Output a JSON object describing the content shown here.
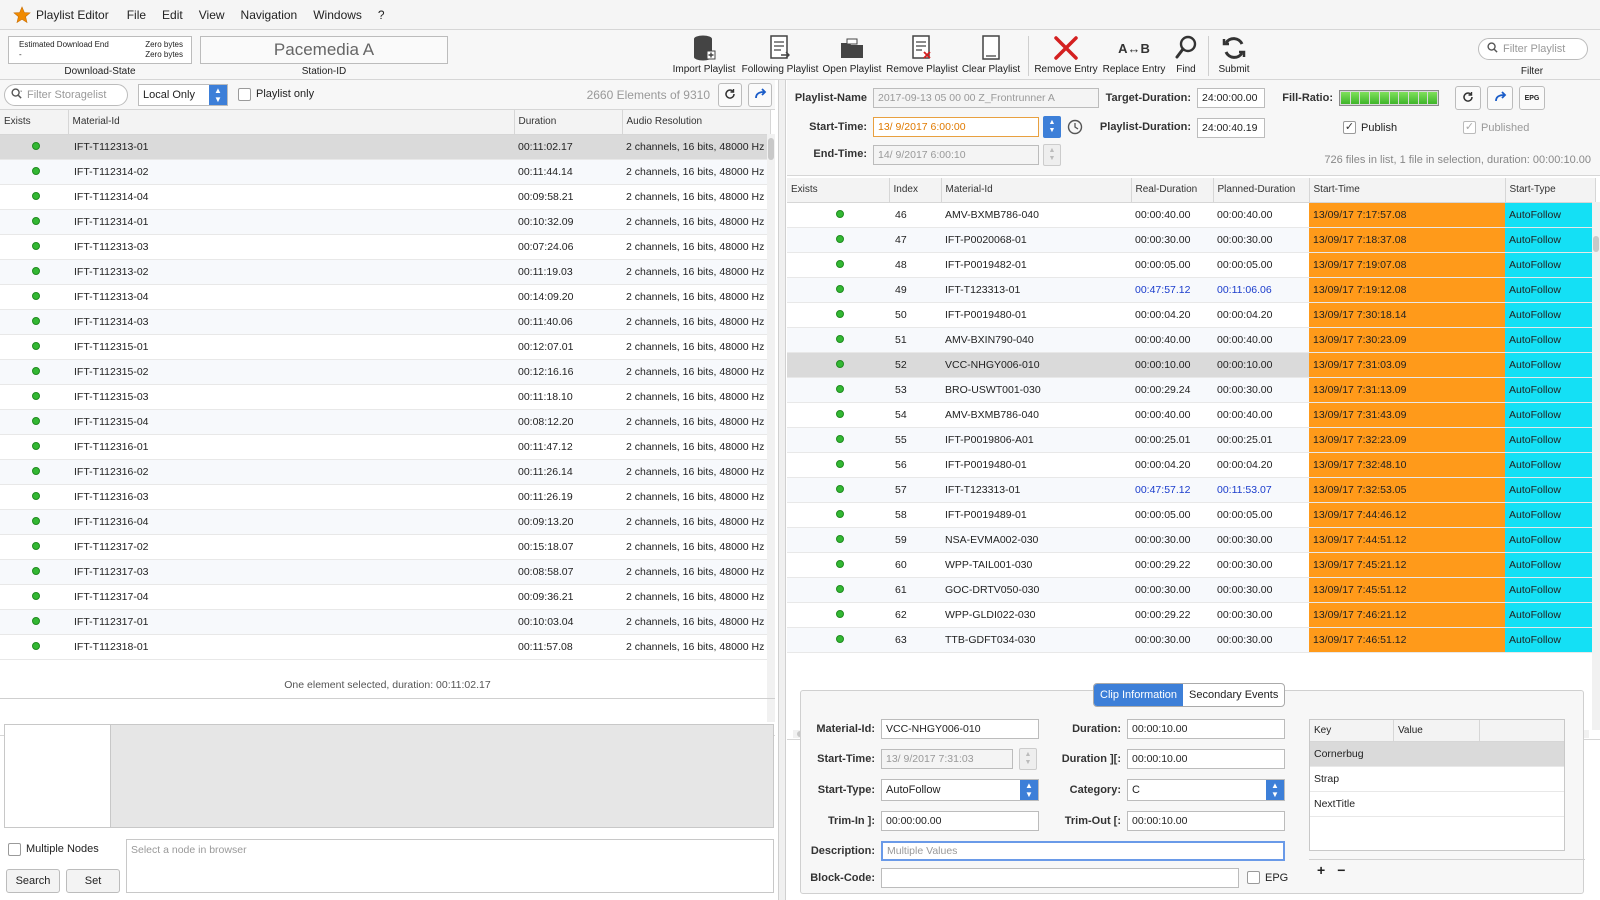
{
  "menubar": {
    "app_title": "Playlist Editor",
    "items": [
      "File",
      "Edit",
      "View",
      "Navigation",
      "Windows",
      "?"
    ]
  },
  "toolbar": {
    "download_state": {
      "line1_left": "Estimated Download End",
      "line2_left": "-",
      "line1_right": "Zero bytes",
      "line2_right": "Zero bytes",
      "caption": "Download-State"
    },
    "station": {
      "value": "Pacemedia A",
      "caption": "Station-ID"
    },
    "buttons": {
      "import": "Import Playlist",
      "following": "Following Playlist",
      "open": "Open Playlist",
      "remove_playlist": "Remove Playlist",
      "clear": "Clear Playlist",
      "remove_entry": "Remove Entry",
      "replace_icon_text": "A↔B",
      "replace": "Replace Entry",
      "find": "Find",
      "submit": "Submit"
    },
    "filter_placeholder": "Filter Playlist",
    "filter_caption": "Filter"
  },
  "left": {
    "filter_placeholder": "Filter Storagelist",
    "scope_select": "Local Only",
    "playlist_only_label": "Playlist only",
    "element_count": "2660 Elements of 9310",
    "columns": [
      "Exists",
      "Material-Id",
      "Duration",
      "Audio Resolution"
    ],
    "rows": [
      [
        "IFT-T112313-01",
        "00:11:02.17",
        "2 channels, 16 bits, 48000 Hz"
      ],
      [
        "IFT-T112314-02",
        "00:11:44.14",
        "2 channels, 16 bits, 48000 Hz"
      ],
      [
        "IFT-T112314-04",
        "00:09:58.21",
        "2 channels, 16 bits, 48000 Hz"
      ],
      [
        "IFT-T112314-01",
        "00:10:32.09",
        "2 channels, 16 bits, 48000 Hz"
      ],
      [
        "IFT-T112313-03",
        "00:07:24.06",
        "2 channels, 16 bits, 48000 Hz"
      ],
      [
        "IFT-T112313-02",
        "00:11:19.03",
        "2 channels, 16 bits, 48000 Hz"
      ],
      [
        "IFT-T112313-04",
        "00:14:09.20",
        "2 channels, 16 bits, 48000 Hz"
      ],
      [
        "IFT-T112314-03",
        "00:11:40.06",
        "2 channels, 16 bits, 48000 Hz"
      ],
      [
        "IFT-T112315-01",
        "00:12:07.01",
        "2 channels, 16 bits, 48000 Hz"
      ],
      [
        "IFT-T112315-02",
        "00:12:16.16",
        "2 channels, 16 bits, 48000 Hz"
      ],
      [
        "IFT-T112315-03",
        "00:11:18.10",
        "2 channels, 16 bits, 48000 Hz"
      ],
      [
        "IFT-T112315-04",
        "00:08:12.20",
        "2 channels, 16 bits, 48000 Hz"
      ],
      [
        "IFT-T112316-01",
        "00:11:47.12",
        "2 channels, 16 bits, 48000 Hz"
      ],
      [
        "IFT-T112316-02",
        "00:11:26.14",
        "2 channels, 16 bits, 48000 Hz"
      ],
      [
        "IFT-T112316-03",
        "00:11:26.19",
        "2 channels, 16 bits, 48000 Hz"
      ],
      [
        "IFT-T112316-04",
        "00:09:13.20",
        "2 channels, 16 bits, 48000 Hz"
      ],
      [
        "IFT-T112317-02",
        "00:15:18.07",
        "2 channels, 16 bits, 48000 Hz"
      ],
      [
        "IFT-T112317-03",
        "00:08:58.07",
        "2 channels, 16 bits, 48000 Hz"
      ],
      [
        "IFT-T112317-04",
        "00:09:36.21",
        "2 channels, 16 bits, 48000 Hz"
      ],
      [
        "IFT-T112317-01",
        "00:10:03.04",
        "2 channels, 16 bits, 48000 Hz"
      ],
      [
        "IFT-T112318-01",
        "00:11:57.08",
        "2 channels, 16 bits, 48000 Hz"
      ]
    ],
    "status": "One element selected, duration: 00:11:02.17",
    "multiple_nodes_label": "Multiple Nodes",
    "node_placeholder": "Select a node in browser",
    "search_label": "Search",
    "set_label": "Set"
  },
  "right": {
    "playlist_name_label": "Playlist-Name",
    "playlist_name": "2017-09-13 05 00 00 Z_Frontrunner A",
    "target_duration_label": "Target-Duration:",
    "target_duration": "24:00:00.00",
    "fill_ratio_label": "Fill-Ratio:",
    "fill_ratio": 1.0,
    "epg_label": "EPG",
    "start_time_label": "Start-Time:",
    "start_time": "13/ 9/2017   6:00:00",
    "playlist_duration_label": "Playlist-Duration:",
    "playlist_duration": "24:00:40.19",
    "publish_label": "Publish",
    "published_label": "Published",
    "end_time_label": "End-Time:",
    "end_time": "14/ 9/2017   6:00:10",
    "summary": "726 files in list, 1 file in selection, duration: 00:00:10.00",
    "columns": [
      "Exists",
      "Index",
      "Material-Id",
      "Real-Duration",
      "Planned-Duration",
      "Start-Time",
      "Start-Type"
    ],
    "rows": [
      [
        "46",
        "AMV-BXMB786-040",
        "00:00:40.00",
        "00:00:40.00",
        "13/09/17 7:17:57.08",
        "AutoFollow"
      ],
      [
        "47",
        "IFT-P0020068-01",
        "00:00:30.00",
        "00:00:30.00",
        "13/09/17 7:18:37.08",
        "AutoFollow"
      ],
      [
        "48",
        "IFT-P0019482-01",
        "00:00:05.00",
        "00:00:05.00",
        "13/09/17 7:19:07.08",
        "AutoFollow"
      ],
      [
        "49",
        "IFT-T123313-01",
        "00:47:57.12",
        "00:11:06.06",
        "13/09/17 7:19:12.08",
        "AutoFollow"
      ],
      [
        "50",
        "IFT-P0019480-01",
        "00:00:04.20",
        "00:00:04.20",
        "13/09/17 7:30:18.14",
        "AutoFollow"
      ],
      [
        "51",
        "AMV-BXIN790-040",
        "00:00:40.00",
        "00:00:40.00",
        "13/09/17 7:30:23.09",
        "AutoFollow"
      ],
      [
        "52",
        "VCC-NHGY006-010",
        "00:00:10.00",
        "00:00:10.00",
        "13/09/17 7:31:03.09",
        "AutoFollow"
      ],
      [
        "53",
        "BRO-USWT001-030",
        "00:00:29.24",
        "00:00:30.00",
        "13/09/17 7:31:13.09",
        "AutoFollow"
      ],
      [
        "54",
        "AMV-BXMB786-040",
        "00:00:40.00",
        "00:00:40.00",
        "13/09/17 7:31:43.09",
        "AutoFollow"
      ],
      [
        "55",
        "IFT-P0019806-A01",
        "00:00:25.01",
        "00:00:25.01",
        "13/09/17 7:32:23.09",
        "AutoFollow"
      ],
      [
        "56",
        "IFT-P0019480-01",
        "00:00:04.20",
        "00:00:04.20",
        "13/09/17 7:32:48.10",
        "AutoFollow"
      ],
      [
        "57",
        "IFT-T123313-01",
        "00:47:57.12",
        "00:11:53.07",
        "13/09/17 7:32:53.05",
        "AutoFollow"
      ],
      [
        "58",
        "IFT-P0019489-01",
        "00:00:05.00",
        "00:00:05.00",
        "13/09/17 7:44:46.12",
        "AutoFollow"
      ],
      [
        "59",
        "NSA-EVMA002-030",
        "00:00:30.00",
        "00:00:30.00",
        "13/09/17 7:44:51.12",
        "AutoFollow"
      ],
      [
        "60",
        "WPP-TAIL001-030",
        "00:00:29.22",
        "00:00:30.00",
        "13/09/17 7:45:21.12",
        "AutoFollow"
      ],
      [
        "61",
        "GOC-DRTV050-030",
        "00:00:30.00",
        "00:00:30.00",
        "13/09/17 7:45:51.12",
        "AutoFollow"
      ],
      [
        "62",
        "WPP-GLDI022-030",
        "00:00:29.22",
        "00:00:30.00",
        "13/09/17 7:46:21.12",
        "AutoFollow"
      ],
      [
        "63",
        "TTB-GDFT034-030",
        "00:00:30.00",
        "00:00:30.00",
        "13/09/17 7:46:51.12",
        "AutoFollow"
      ]
    ]
  },
  "clip": {
    "tab_clip": "Clip Information",
    "tab_secondary": "Secondary Events",
    "material_id_label": "Material-Id:",
    "material_id": "VCC-NHGY006-010",
    "duration_label": "Duration:",
    "duration": "00:00:10.00",
    "start_time_label": "Start-Time:",
    "start_time": "13/ 9/2017   7:31:03",
    "duration2_label": "Duration ][:",
    "duration2": "00:00:10.00",
    "start_type_label": "Start-Type:",
    "start_type": "AutoFollow",
    "category_label": "Category:",
    "category": "C",
    "trim_in_label": "Trim-In ]:",
    "trim_in": "00:00:00.00",
    "trim_out_label": "Trim-Out [:",
    "trim_out": "00:00:10.00",
    "description_label": "Description:",
    "description_placeholder": "Multiple Values",
    "block_code_label": "Block-Code:",
    "epg_label": "EPG",
    "kv_key": "Key",
    "kv_value": "Value",
    "kv_rows": [
      "Cornerbug",
      "Strap",
      "NextTitle"
    ]
  },
  "colors": {
    "accent": "#3d7fd8",
    "start_time_cell": "#ff9a1a",
    "start_type_cell": "#14e0f5",
    "exists_dot": "#33b833",
    "remove_red": "#d42020"
  }
}
